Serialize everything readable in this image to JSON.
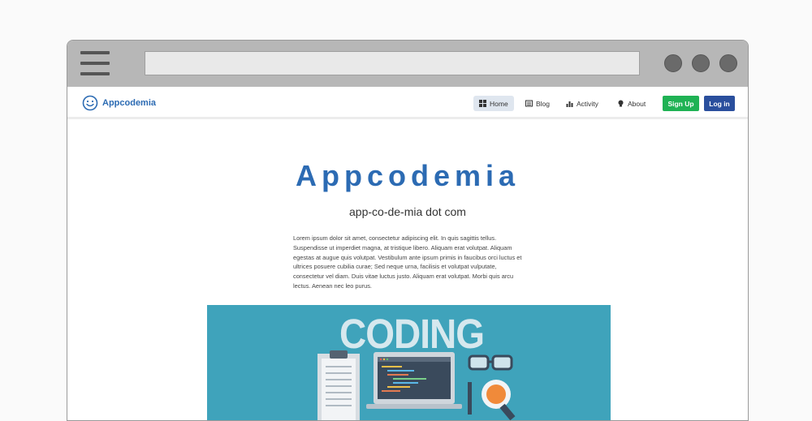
{
  "site": {
    "brand": "Appcodemia"
  },
  "nav": {
    "items": [
      {
        "label": "Home",
        "icon": "grid-icon",
        "active": true
      },
      {
        "label": "Blog",
        "icon": "newspaper-icon",
        "active": false
      },
      {
        "label": "Activity",
        "icon": "chart-icon",
        "active": false
      },
      {
        "label": "About",
        "icon": "lightbulb-icon",
        "active": false
      }
    ],
    "signup_label": "Sign Up",
    "login_label": "Log in"
  },
  "hero": {
    "title": "Appcodemia",
    "subtitle": "app-co-de-mia dot com",
    "body": "Lorem ipsum dolor sit amet, consectetur adipiscing elit. In quis sagittis tellus. Suspendisse ut imperdiet magna, at tristique libero. Aliquam erat volutpat. Aliquam egestas at augue quis volutpat. Vestibulum ante ipsum primis in faucibus orci luctus et ultrices posuere cubilia curae; Sed neque urna, facilisis et volutpat vulputate, consectetur vel diam. Duis vitae luctus justo. Aliquam erat volutpat. Morbi quis arcu lectus. Aenean nec leo purus.",
    "image_text": "CODING"
  },
  "colors": {
    "brand_blue": "#2c6bb3",
    "signup_green": "#1fb254",
    "login_blue": "#2a4f9d",
    "image_bg": "#3fa3bb"
  }
}
